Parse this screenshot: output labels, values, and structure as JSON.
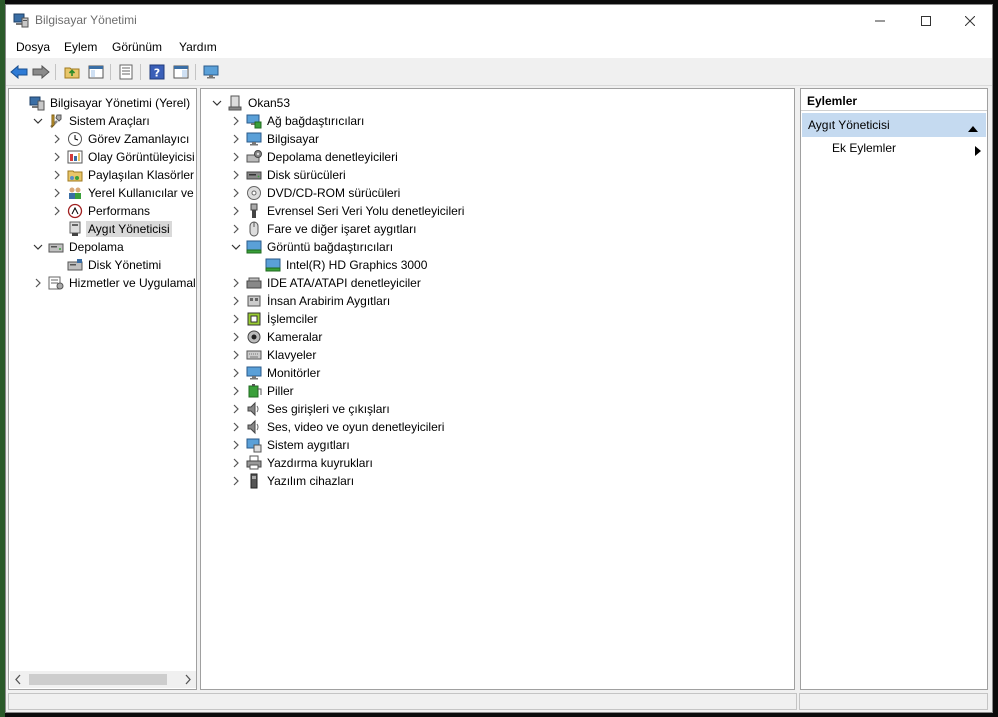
{
  "window": {
    "title": "Bilgisayar Yönetimi",
    "minimize_icon": "minimize-icon",
    "maximize_icon": "maximize-icon",
    "close_icon": "close-icon"
  },
  "menu": [
    "Dosya",
    "Eylem",
    "Görünüm",
    "Yardım"
  ],
  "toolbar": [
    "back-arrow-icon",
    "forward-arrow-icon",
    "up-folder-icon",
    "show-hide-tree-icon",
    "properties-icon",
    "help-icon",
    "show-hide-action-pane-icon",
    "monitor-icon"
  ],
  "left_tree": [
    {
      "label": "Bilgisayar Yönetimi (Yerel)",
      "level": 0,
      "expander": "none",
      "icon": "computer-management-icon"
    },
    {
      "label": "Sistem Araçları",
      "level": 1,
      "expander": "expanded",
      "icon": "tools-icon"
    },
    {
      "label": "Görev Zamanlayıcı",
      "level": 2,
      "expander": "collapsed",
      "icon": "clock-icon"
    },
    {
      "label": "Olay Görüntüleyicisi",
      "level": 2,
      "expander": "collapsed",
      "icon": "event-viewer-icon"
    },
    {
      "label": "Paylaşılan Klasörler",
      "level": 2,
      "expander": "collapsed",
      "icon": "shared-folder-icon"
    },
    {
      "label": "Yerel Kullanıcılar ve Gru",
      "level": 2,
      "expander": "collapsed",
      "icon": "users-icon"
    },
    {
      "label": "Performans",
      "level": 2,
      "expander": "collapsed",
      "icon": "performance-icon"
    },
    {
      "label": "Aygıt Yöneticisi",
      "level": 2,
      "expander": "none",
      "icon": "device-manager-icon",
      "selected": true
    },
    {
      "label": "Depolama",
      "level": 1,
      "expander": "expanded",
      "icon": "storage-icon"
    },
    {
      "label": "Disk Yönetimi",
      "level": 2,
      "expander": "none",
      "icon": "disk-management-icon"
    },
    {
      "label": "Hizmetler ve Uygulamalar",
      "level": 1,
      "expander": "collapsed",
      "icon": "services-icon"
    }
  ],
  "device_tree": [
    {
      "label": "Okan53",
      "level": 0,
      "expander": "expanded",
      "icon": "computer-icon"
    },
    {
      "label": "Ağ bağdaştırıcıları",
      "level": 1,
      "expander": "collapsed",
      "icon": "network-adapter-icon"
    },
    {
      "label": "Bilgisayar",
      "level": 1,
      "expander": "collapsed",
      "icon": "monitor-icon"
    },
    {
      "label": "Depolama denetleyicileri",
      "level": 1,
      "expander": "collapsed",
      "icon": "storage-controller-icon"
    },
    {
      "label": "Disk sürücüleri",
      "level": 1,
      "expander": "collapsed",
      "icon": "disk-drive-icon"
    },
    {
      "label": "DVD/CD-ROM sürücüleri",
      "level": 1,
      "expander": "collapsed",
      "icon": "dvd-icon"
    },
    {
      "label": "Evrensel Seri Veri Yolu denetleyicileri",
      "level": 1,
      "expander": "collapsed",
      "icon": "usb-icon"
    },
    {
      "label": "Fare ve diğer işaret aygıtları",
      "level": 1,
      "expander": "collapsed",
      "icon": "mouse-icon"
    },
    {
      "label": "Görüntü bağdaştırıcıları",
      "level": 1,
      "expander": "expanded",
      "icon": "display-adapter-icon"
    },
    {
      "label": "Intel(R) HD Graphics 3000",
      "level": 2,
      "expander": "none",
      "icon": "display-adapter-icon"
    },
    {
      "label": "IDE ATA/ATAPI denetleyiciler",
      "level": 1,
      "expander": "collapsed",
      "icon": "ide-icon"
    },
    {
      "label": "İnsan Arabirim Aygıtları",
      "level": 1,
      "expander": "collapsed",
      "icon": "hid-icon"
    },
    {
      "label": "İşlemciler",
      "level": 1,
      "expander": "collapsed",
      "icon": "processor-icon"
    },
    {
      "label": "Kameralar",
      "level": 1,
      "expander": "collapsed",
      "icon": "camera-icon"
    },
    {
      "label": "Klavyeler",
      "level": 1,
      "expander": "collapsed",
      "icon": "keyboard-icon"
    },
    {
      "label": "Monitörler",
      "level": 1,
      "expander": "collapsed",
      "icon": "monitor-icon"
    },
    {
      "label": "Piller",
      "level": 1,
      "expander": "collapsed",
      "icon": "battery-icon"
    },
    {
      "label": "Ses girişleri ve çıkışları",
      "level": 1,
      "expander": "collapsed",
      "icon": "speaker-icon"
    },
    {
      "label": "Ses, video ve oyun denetleyicileri",
      "level": 1,
      "expander": "collapsed",
      "icon": "speaker-icon"
    },
    {
      "label": "Sistem aygıtları",
      "level": 1,
      "expander": "collapsed",
      "icon": "system-devices-icon"
    },
    {
      "label": "Yazdırma kuyrukları",
      "level": 1,
      "expander": "collapsed",
      "icon": "printer-icon"
    },
    {
      "label": "Yazılım cihazları",
      "level": 1,
      "expander": "collapsed",
      "icon": "software-device-icon"
    }
  ],
  "actions": {
    "header": "Eylemler",
    "section": "Aygıt Yöneticisi",
    "sub_item": "Ek Eylemler",
    "collapse_icon": "triangle-up-icon",
    "submenu_icon": "triangle-right-icon"
  }
}
